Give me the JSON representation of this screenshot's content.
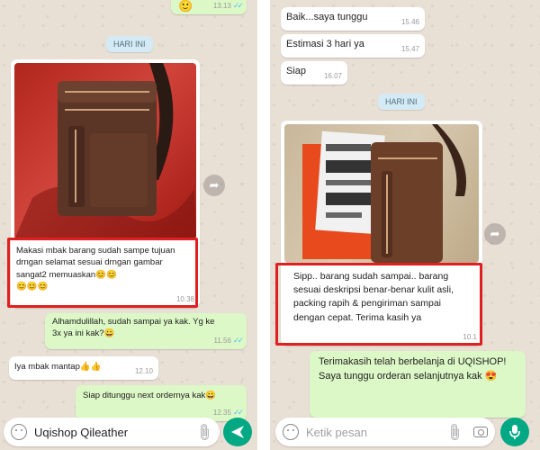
{
  "left": {
    "top_time": "13.13",
    "date_chip": "HARI INI",
    "photo_caption": "Makasi mbak barang sudah sampe tujuan drngan selamat sesuai drngan gambar sangat2 memuaskan😊😊",
    "photo_caption_emoji": "😊😊😊",
    "photo_time": "10.38",
    "msg_alhamdulillah": "Alhamdulillah, sudah sampai ya kak. Yg ke 3x ya ini kak?😀",
    "msg_alhamdulillah_time": "11.56",
    "msg_mantap": "Iya mbak mantap👍👍",
    "msg_mantap_time": "12.10",
    "msg_siap": "Siap ditunggu next ordernya kak😀",
    "msg_siap_time": "12.35",
    "input_value": "Uqishop Qileather",
    "colors": {
      "chat_bg": "#e8dfd5",
      "outgoing": "#dcf8c6",
      "highlight": "#e02020",
      "send": "#00a884"
    }
  },
  "right": {
    "msg_baik": "Baik...saya tunggu",
    "msg_baik_time": "15.46",
    "msg_estimasi": "Estimasi 3 hari ya",
    "msg_estimasi_time": "15.47",
    "msg_siap": "Siap",
    "msg_siap_time": "16.07",
    "date_chip": "HARI INI",
    "photo_caption": "Sipp.. barang sudah sampai.. barang sesuai deskripsi benar-benar kulit asli, packing rapih & pengiriman sampai dengan cepat. Terima kasih ya",
    "photo_time": "10.1",
    "msg_terimakasih": "Terimakasih telah berbelanja di UQISHOP! Saya tunggu orderan selanjutnya kak 😍",
    "input_placeholder": "Ketik pesan"
  },
  "icons": [
    "forward-icon",
    "emoji-icon",
    "attach-icon",
    "camera-icon",
    "send-icon",
    "mic-icon",
    "double-check-icon"
  ]
}
